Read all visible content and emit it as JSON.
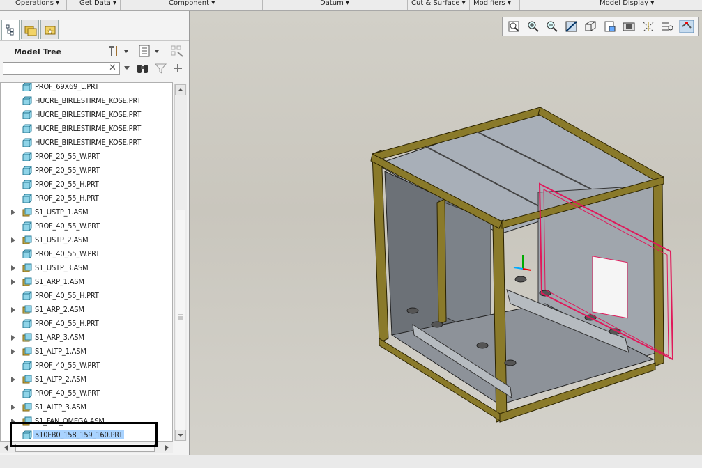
{
  "menubar": {
    "items": [
      {
        "label": "Operations ▾"
      },
      {
        "label": "Get Data ▾"
      },
      {
        "label": "Component ▾"
      },
      {
        "label": "Datum ▾"
      },
      {
        "label": "Cut & Surface ▾"
      },
      {
        "label": "Modifiers ▾"
      },
      {
        "label": "Model Display ▾"
      }
    ]
  },
  "tabs": [
    {
      "icon": "model-tree-icon"
    },
    {
      "icon": "folder-browser-icon"
    },
    {
      "icon": "favorites-icon"
    }
  ],
  "model_tree": {
    "title": "Model Tree",
    "search": {
      "value": "",
      "placeholder": ""
    },
    "items": [
      {
        "label": "PROF_69X69_L.PRT",
        "type": "part",
        "expandable": false
      },
      {
        "label": "HUCRE_BIRLESTIRME_KOSE.PRT",
        "type": "part",
        "expandable": false
      },
      {
        "label": "HUCRE_BIRLESTIRME_KOSE.PRT",
        "type": "part",
        "expandable": false
      },
      {
        "label": "HUCRE_BIRLESTIRME_KOSE.PRT",
        "type": "part",
        "expandable": false
      },
      {
        "label": "HUCRE_BIRLESTIRME_KOSE.PRT",
        "type": "part",
        "expandable": false
      },
      {
        "label": "PROF_20_55_W.PRT",
        "type": "part",
        "expandable": false
      },
      {
        "label": "PROF_20_55_W.PRT",
        "type": "part",
        "expandable": false
      },
      {
        "label": "PROF_20_55_H.PRT",
        "type": "part",
        "expandable": false
      },
      {
        "label": "PROF_20_55_H.PRT",
        "type": "part",
        "expandable": false
      },
      {
        "label": "S1_USTP_1.ASM",
        "type": "assembly",
        "expandable": true
      },
      {
        "label": "PROF_40_55_W.PRT",
        "type": "part",
        "expandable": false
      },
      {
        "label": "S1_USTP_2.ASM",
        "type": "assembly",
        "expandable": true
      },
      {
        "label": "PROF_40_55_W.PRT",
        "type": "part",
        "expandable": false
      },
      {
        "label": "S1_USTP_3.ASM",
        "type": "assembly",
        "expandable": true
      },
      {
        "label": "S1_ARP_1.ASM",
        "type": "assembly",
        "expandable": true
      },
      {
        "label": "PROF_40_55_H.PRT",
        "type": "part",
        "expandable": false
      },
      {
        "label": "S1_ARP_2.ASM",
        "type": "assembly",
        "expandable": true
      },
      {
        "label": "PROF_40_55_H.PRT",
        "type": "part",
        "expandable": false
      },
      {
        "label": "S1_ARP_3.ASM",
        "type": "assembly",
        "expandable": true
      },
      {
        "label": "S1_ALTP_1.ASM",
        "type": "assembly",
        "expandable": true
      },
      {
        "label": "PROF_40_55_W.PRT",
        "type": "part",
        "expandable": false
      },
      {
        "label": "S1_ALTP_2.ASM",
        "type": "assembly",
        "expandable": true
      },
      {
        "label": "PROF_40_55_W.PRT",
        "type": "part",
        "expandable": false
      },
      {
        "label": "S1_ALTP_3.ASM",
        "type": "assembly",
        "expandable": true
      },
      {
        "label": "S1_FAN_OMEGA.ASM",
        "type": "assembly",
        "expandable": true
      },
      {
        "label": "510FB0_158_159_160.PRT",
        "type": "part",
        "expandable": false,
        "selected": true
      }
    ]
  },
  "viewport_toolbar": [
    {
      "icon": "refit-icon"
    },
    {
      "icon": "zoom-in-icon"
    },
    {
      "icon": "zoom-out-icon"
    },
    {
      "icon": "repaint-icon"
    },
    {
      "icon": "display-style-icon"
    },
    {
      "icon": "saved-views-icon"
    },
    {
      "icon": "view-manager-icon"
    },
    {
      "icon": "datum-display-icon"
    },
    {
      "icon": "spin-center-icon"
    },
    {
      "icon": "annotation-display-icon"
    }
  ],
  "colors": {
    "frame": "#8a7a2a",
    "panel": "#9ea3a8",
    "selection": "#e0185a",
    "tree_selected": "#a9d3ff"
  }
}
